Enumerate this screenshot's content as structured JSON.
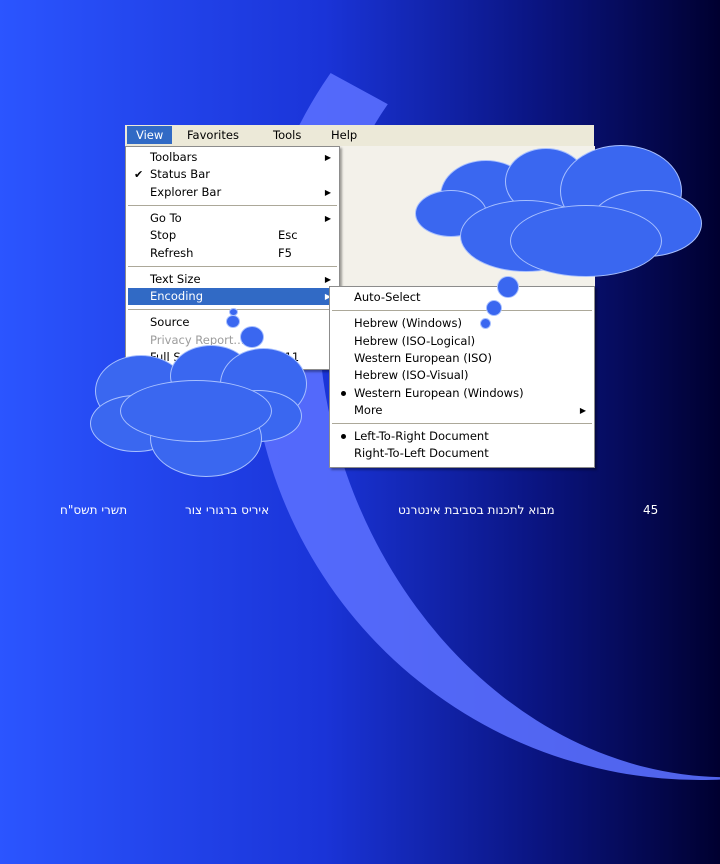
{
  "menubar": [
    "View",
    "Favorites",
    "Tools",
    "Help"
  ],
  "view_menu": [
    {
      "label": "Toolbars",
      "arrow": true
    },
    {
      "label": "Status Bar",
      "check": true
    },
    {
      "label": "Explorer Bar",
      "arrow": true
    },
    {
      "sep": true
    },
    {
      "label": "Go To",
      "arrow": true
    },
    {
      "label": "Stop",
      "shortcut": "Esc"
    },
    {
      "label": "Refresh",
      "shortcut": "F5"
    },
    {
      "sep": true
    },
    {
      "label": "Text Size",
      "arrow": true
    },
    {
      "label": "Encoding",
      "arrow": true,
      "highlight": true
    },
    {
      "sep": true
    },
    {
      "label": "Source"
    },
    {
      "label": "Privacy Report...",
      "disabled": true
    },
    {
      "label": "Full Screen",
      "shortcut": "F11"
    }
  ],
  "encoding_menu": [
    {
      "label": "Auto-Select"
    },
    {
      "sep": true
    },
    {
      "label": "Hebrew (Windows)"
    },
    {
      "label": "Hebrew (ISO-Logical)"
    },
    {
      "label": "Western European (ISO)"
    },
    {
      "label": "Hebrew (ISO-Visual)"
    },
    {
      "label": "Western European (Windows)",
      "radio": true
    },
    {
      "label": "More",
      "arrow": true
    },
    {
      "sep": true
    },
    {
      "label": "Left-To-Right Document",
      "radio": true
    },
    {
      "label": "Right-To-Left Document"
    }
  ],
  "footer": {
    "left": "תשרי תשס\"ח",
    "center_left": "איריס ברגורי צור",
    "center_right": "מבוא לתכנות בסביבת אינטרנט",
    "page": "45"
  },
  "colors": {
    "highlight": "#316ac5",
    "cloud": "#3a67f0"
  }
}
